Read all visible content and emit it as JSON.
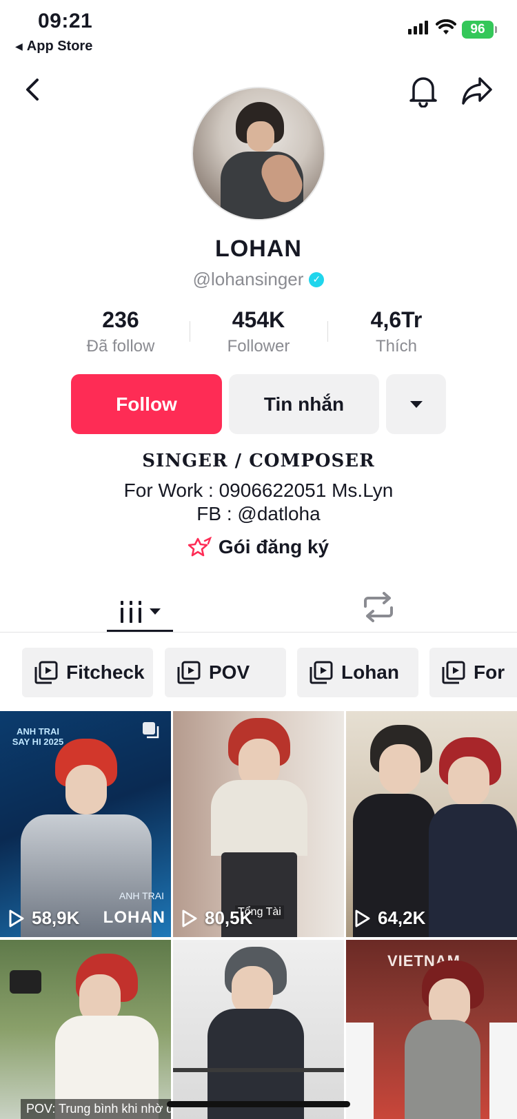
{
  "status_bar": {
    "time": "09:21",
    "back_app": "App Store",
    "battery": "96"
  },
  "profile": {
    "display_name": "LOHAN",
    "username": "@lohansinger",
    "stats": [
      {
        "value": "236",
        "label": "Đã follow"
      },
      {
        "value": "454K",
        "label": "Follower"
      },
      {
        "value": "4,6Tr",
        "label": "Thích"
      }
    ],
    "follow_label": "Follow",
    "message_label": "Tin nhắn",
    "bio_title": "SINGER / COMPOSER",
    "bio_lines": [
      "For Work : 0906622051 Ms.Lyn",
      "FB : @datloha"
    ],
    "subscription_label": "Gói đăng ký"
  },
  "playlists": [
    "Fitcheck",
    "POV",
    "Lohan",
    "For"
  ],
  "videos": [
    {
      "views": "58,9K",
      "overlay_top": "ANH TRAI",
      "overlay_brand": "LOHAN",
      "overlay_header": "ANH TRAI SAY HI 2025"
    },
    {
      "views": "80,5K",
      "overlay_text": "Tổng Tài"
    },
    {
      "views": "64,2K"
    },
    {
      "caption": "POV: Trung bình khi nhờ đứa"
    },
    {},
    {
      "overlay_text": "VIETNAM"
    }
  ],
  "colors": {
    "accent": "#fe2c55",
    "verified": "#20d5ec",
    "battery": "#34c759"
  }
}
